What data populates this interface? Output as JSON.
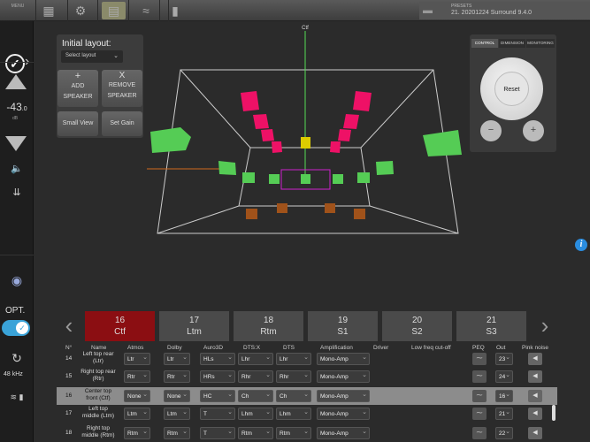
{
  "toolbar": {
    "menu_label": "MENU",
    "icons": [
      "grid-icon",
      "gear-icon",
      "check-icon",
      "layout-icon",
      "stream-icon",
      "mic-icon"
    ],
    "presets_label": "PRESETS",
    "presets_value": "21. 20201224 Surround 9.4.0"
  },
  "sidebar": {
    "gain_value": "-43",
    "gain_decimal": ".0",
    "gain_unit": "dB",
    "opt_label": "OPT.",
    "sample_rate": "48 kHz"
  },
  "layout_panel": {
    "title": "Initial layout:",
    "select_placeholder": "Select layout",
    "add_icon": "+",
    "add_label_1": "ADD",
    "add_label_2": "SPEAKER",
    "remove_icon": "X",
    "remove_label_1": "REMOVE",
    "remove_label_2": "SPEAKER",
    "small_view": "Small View",
    "set_gain": "Set Gain"
  },
  "viewport": {
    "center_label": "Ctf",
    "colors": {
      "top": "#ee1166",
      "center": "#ddcc00",
      "ear": "#55cc55",
      "bottom": "#a0521a",
      "green_line": "#55dd55",
      "selection": "#cc22cc",
      "orange_line": "#d2691e"
    }
  },
  "control_panel": {
    "tabs": [
      "CONTROL",
      "DIMENSION",
      "MONITORING"
    ],
    "reset_label": "Reset",
    "zoom_out": "−",
    "zoom_in": "+"
  },
  "channels": {
    "items": [
      {
        "num": "16",
        "name": "Ctf",
        "selected": true
      },
      {
        "num": "17",
        "name": "Ltm",
        "selected": false
      },
      {
        "num": "18",
        "name": "Rtm",
        "selected": false
      },
      {
        "num": "19",
        "name": "S1",
        "selected": false
      },
      {
        "num": "20",
        "name": "S2",
        "selected": false
      },
      {
        "num": "21",
        "name": "S3",
        "selected": false
      }
    ]
  },
  "table": {
    "headers": [
      "N°",
      "Name",
      "Atmos",
      "Dolby",
      "Auro3D",
      "DTS:X",
      "DTS",
      "Amplification",
      "Driver",
      "Low freq cut-off",
      "PEQ",
      "Out",
      "Pink noise"
    ],
    "rows": [
      {
        "n": "14",
        "name1": "Left top rear",
        "name2": "(Ltr)",
        "atmos": "Ltr",
        "dolby": "Ltr",
        "auro": "HLs",
        "dtsx": "Lhr",
        "dts": "Lhr",
        "amp": "Mono-Amp",
        "out": "23",
        "hl": false
      },
      {
        "n": "15",
        "name1": "Right top rear",
        "name2": "(Rtr)",
        "atmos": "Rtr",
        "dolby": "Rtr",
        "auro": "HRs",
        "dtsx": "Rhr",
        "dts": "Rhr",
        "amp": "Mono-Amp",
        "out": "24",
        "hl": false
      },
      {
        "n": "16",
        "name1": "Center top",
        "name2": "front (Ctf)",
        "atmos": "None",
        "dolby": "None",
        "auro": "HC",
        "dtsx": "Ch",
        "dts": "Ch",
        "amp": "Mono-Amp",
        "out": "16",
        "hl": true
      },
      {
        "n": "17",
        "name1": "Left top",
        "name2": "middle (Ltm)",
        "atmos": "Ltm",
        "dolby": "Ltm",
        "auro": "T",
        "dtsx": "Lhm",
        "dts": "Lhm",
        "amp": "Mono-Amp",
        "out": "21",
        "hl": false
      },
      {
        "n": "18",
        "name1": "Right top",
        "name2": "middle (Rtm)",
        "atmos": "Rtm",
        "dolby": "Rtm",
        "auro": "T",
        "dtsx": "Rtm",
        "dts": "Rtm",
        "amp": "Mono-Amp",
        "out": "22",
        "hl": false
      }
    ]
  }
}
